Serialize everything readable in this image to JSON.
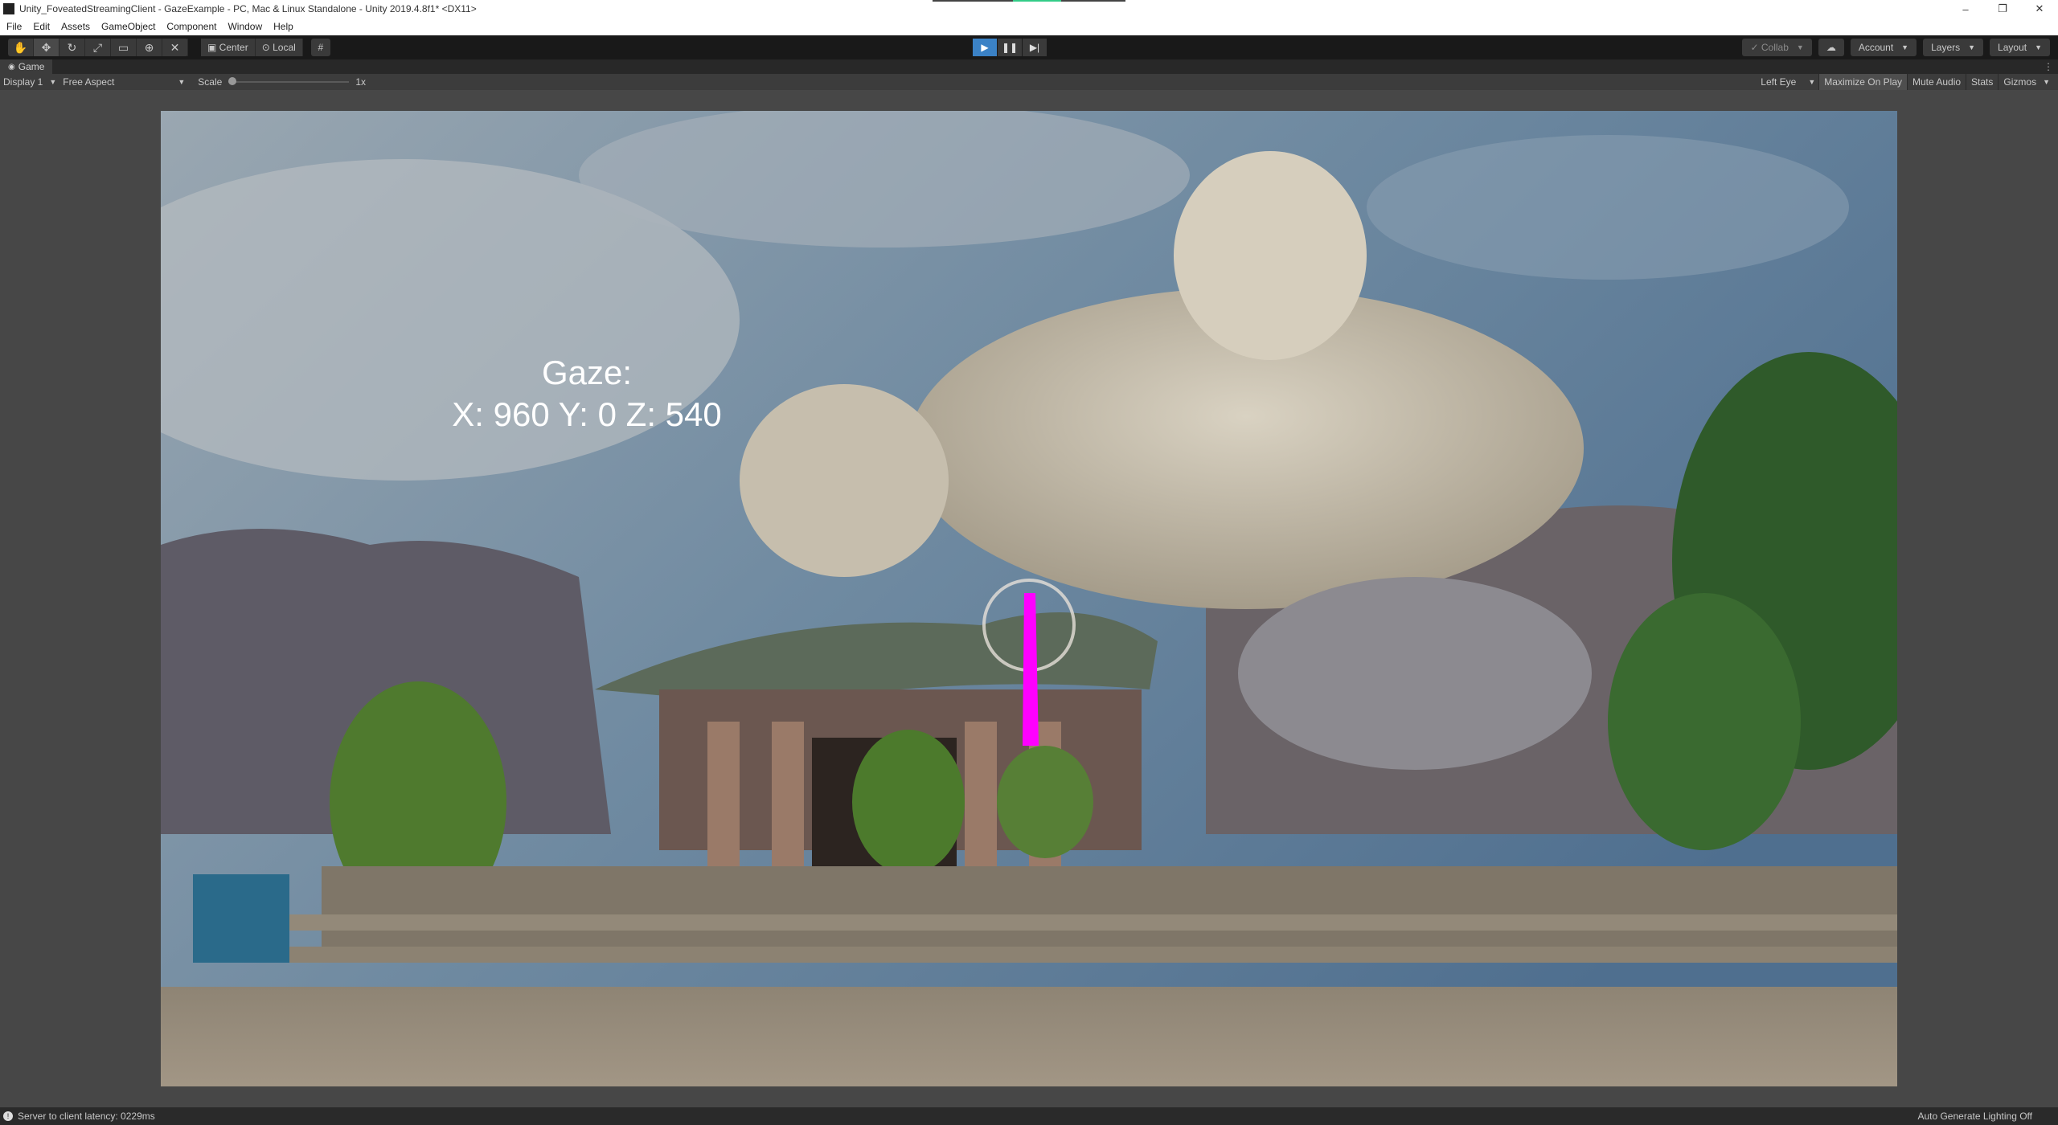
{
  "window": {
    "title": "Unity_FoveatedStreamingClient - GazeExample - PC, Mac & Linux Standalone - Unity 2019.4.8f1* <DX11>",
    "controls": [
      "–",
      "❐",
      "✕"
    ]
  },
  "menu": [
    "File",
    "Edit",
    "Assets",
    "GameObject",
    "Component",
    "Window",
    "Help"
  ],
  "toolbar": {
    "tools": [
      "hand-icon",
      "move-icon",
      "rotate-icon",
      "scale-icon",
      "rect-icon",
      "transform-icon",
      "custom-tool-icon"
    ],
    "pivot_label": "Center",
    "space_label": "Local",
    "collab_label": "Collab",
    "account_label": "Account",
    "layers_label": "Layers",
    "layout_label": "Layout"
  },
  "tab": {
    "label": "Game"
  },
  "game_bar": {
    "display": "Display 1",
    "aspect": "Free Aspect",
    "scale_label": "Scale",
    "scale_value": "1x",
    "eye": "Left Eye",
    "maximize_on_play": "Maximize On Play",
    "mute_audio": "Mute Audio",
    "stats": "Stats",
    "gizmos": "Gizmos"
  },
  "game": {
    "gaze_title": "Gaze:",
    "gaze_coords": "X: 960 Y: 0 Z: 540",
    "gaze_marker_color": "#ff00ff"
  },
  "status": {
    "latency": "Server to client latency: 0229ms",
    "lighting": "Auto Generate Lighting Off"
  }
}
